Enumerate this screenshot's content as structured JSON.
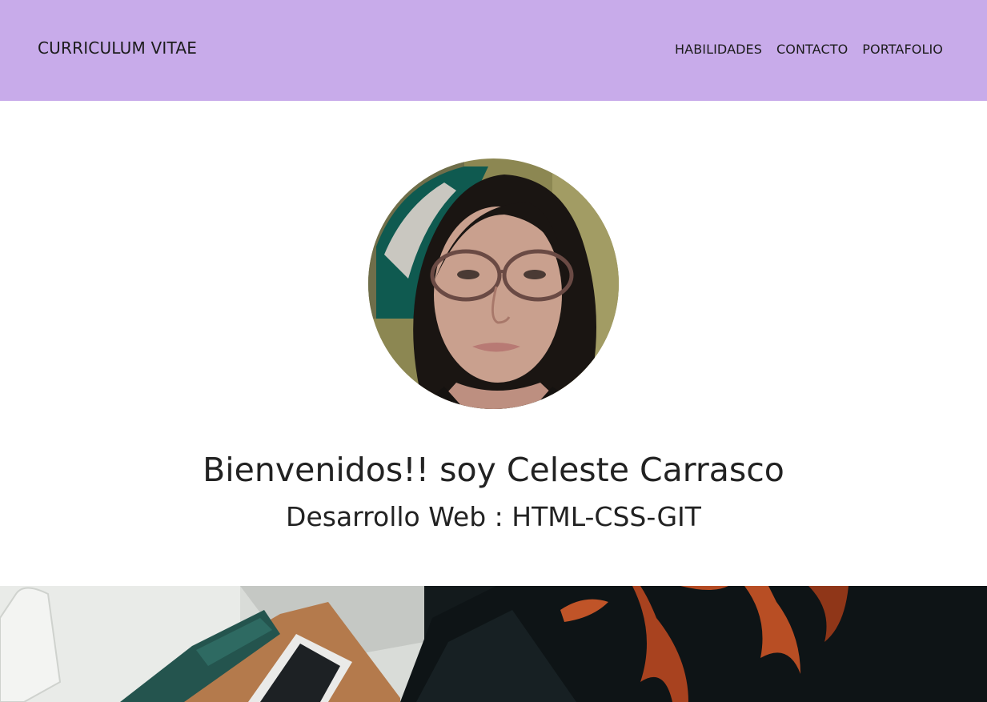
{
  "header": {
    "brand": "CURRICULUM VITAE",
    "nav": [
      {
        "label": "HABILIDADES"
      },
      {
        "label": "CONTACTO"
      },
      {
        "label": "PORTAFOLIO"
      }
    ],
    "background_color": "#c8abea"
  },
  "profile": {
    "photo_icon": "profile-photo",
    "title": "Bienvenidos!! soy Celeste Carrasco",
    "subtitle": "Desarrollo Web : HTML-CSS-GIT"
  },
  "banner": {
    "image": "workspace-photo"
  }
}
